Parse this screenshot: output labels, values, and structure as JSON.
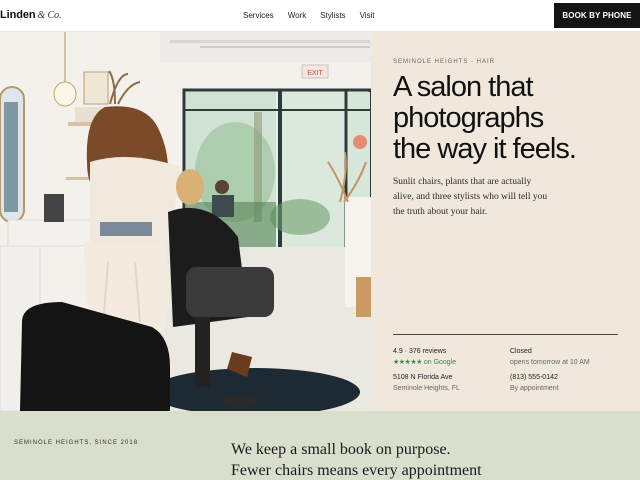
{
  "nav": {
    "brand_name": "Linden",
    "brand_suffix": "& Co.",
    "links": [
      "Services",
      "Work",
      "Stylists",
      "Visit"
    ],
    "cta": "BOOK BY PHONE"
  },
  "hero": {
    "photo_exit_sign": "EXIT",
    "eyebrow": "SEMINOLE HEIGHTS · HAIR",
    "headline_lines": [
      "A salon that",
      "photographs",
      "the way it feels."
    ],
    "intro_lines": [
      "Sunlit chairs, plants that are actually",
      "alive, and three stylists who will tell you",
      "the truth about your hair."
    ]
  },
  "info": {
    "rating": "4.9 · 376 reviews",
    "stars": "★★★★★",
    "rating_source": "on Google",
    "address_line1": "5108 N Florida Ave",
    "address_line2": "Seminole Heights, FL",
    "status": "Closed",
    "status_detail": "opens tomorrow at 10 AM",
    "phone": "(813) 555-0142",
    "phone_note": "By appointment"
  },
  "band": {
    "label": "SEMINOLE HEIGHTS, SINCE 2018",
    "quote_lines": [
      "We keep a small book on purpose.",
      "Fewer chairs means every appointment"
    ]
  },
  "colors": {
    "panel_bg": "#f1e8dd",
    "band_bg": "#dadfcd",
    "cta_bg": "#141414",
    "star_green": "#3a8a4a"
  }
}
